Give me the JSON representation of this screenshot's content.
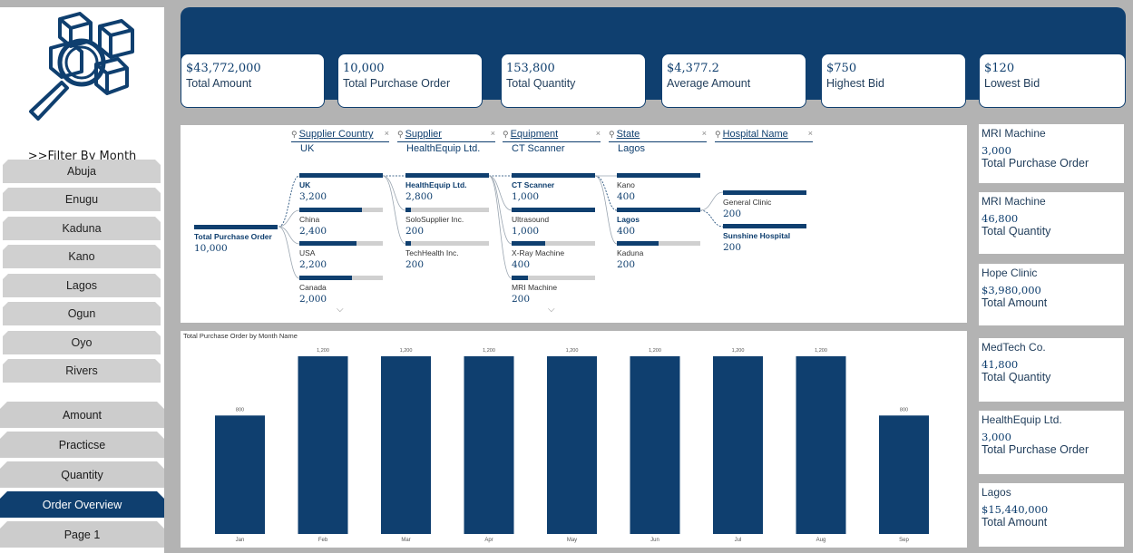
{
  "sidebar": {
    "filter_title": ">>Filter By Month",
    "cities": [
      "Abuja",
      "Enugu",
      "Kaduna",
      "Kano",
      "Lagos",
      "Ogun",
      "Oyo",
      "Rivers"
    ],
    "pages": [
      {
        "label": "Amount",
        "active": false
      },
      {
        "label": "Practicse",
        "active": false
      },
      {
        "label": "Quantity",
        "active": false
      },
      {
        "label": "Order Overview",
        "active": true
      },
      {
        "label": "Page 1",
        "active": false
      }
    ]
  },
  "kpis": [
    {
      "value": "$43,772,000",
      "label": "Total Amount"
    },
    {
      "value": "10,000",
      "label": "Total Purchase Order"
    },
    {
      "value": "153,800",
      "label": "Total Quantity"
    },
    {
      "value": "$4,377.2",
      "label": "Average Amount"
    },
    {
      "value": "$750",
      "label": "Highest Bid"
    },
    {
      "value": "$120",
      "label": "Lowest Bid"
    }
  ],
  "tree": {
    "root": {
      "label": "Total Purchase Order",
      "value": "10,000"
    },
    "levels": [
      {
        "header": "Supplier Country",
        "selected": "UK",
        "nodes": [
          {
            "label": "UK",
            "value": "3,200",
            "fraction": 1.0,
            "sel": true
          },
          {
            "label": "China",
            "value": "2,400",
            "fraction": 0.75
          },
          {
            "label": "USA",
            "value": "2,200",
            "fraction": 0.69
          },
          {
            "label": "Canada",
            "value": "2,000",
            "fraction": 0.63
          }
        ]
      },
      {
        "header": "Supplier",
        "selected": "HealthEquip Ltd.",
        "nodes": [
          {
            "label": "HealthEquip Ltd.",
            "value": "2,800",
            "fraction": 1.0,
            "sel": true
          },
          {
            "label": "SoloSupplier Inc.",
            "value": "200",
            "fraction": 0.07
          },
          {
            "label": "TechHealth Inc.",
            "value": "200",
            "fraction": 0.07
          }
        ]
      },
      {
        "header": "Equipment",
        "selected": "CT Scanner",
        "nodes": [
          {
            "label": "CT Scanner",
            "value": "1,000",
            "fraction": 1.0,
            "sel": true
          },
          {
            "label": "Ultrasound",
            "value": "1,000",
            "fraction": 1.0
          },
          {
            "label": "X-Ray Machine",
            "value": "400",
            "fraction": 0.4
          },
          {
            "label": "MRI Machine",
            "value": "200",
            "fraction": 0.2
          }
        ]
      },
      {
        "header": "State",
        "selected": "Lagos",
        "nodes": [
          {
            "label": "Kano",
            "value": "400",
            "fraction": 1.0
          },
          {
            "label": "Lagos",
            "value": "400",
            "fraction": 1.0,
            "sel": true
          },
          {
            "label": "Kaduna",
            "value": "200",
            "fraction": 0.5
          }
        ]
      },
      {
        "header": "Hospital Name",
        "selected": "",
        "nodes": [
          {
            "label": "General Clinic",
            "value": "200",
            "fraction": 1.0
          },
          {
            "label": "Sunshine Hospital",
            "value": "200",
            "fraction": 1.0,
            "sel": true
          }
        ]
      }
    ]
  },
  "chart_data": {
    "type": "bar",
    "title": "Total Purchase Order by Month Name",
    "categories": [
      "Jan",
      "Feb",
      "Mar",
      "Apr",
      "May",
      "Jun",
      "Jul",
      "Aug",
      "Sep"
    ],
    "values": [
      800,
      1200,
      1200,
      1200,
      1200,
      1200,
      1200,
      1200,
      800
    ],
    "data_labels": [
      "800",
      "1,200",
      "1,200",
      "1,200",
      "1,200",
      "1,200",
      "1,200",
      "1,200",
      "800"
    ],
    "ylim": [
      0,
      1200
    ],
    "color": "#0f3f6f"
  },
  "right_cards": [
    {
      "title": "MRI Machine",
      "value": "3,000",
      "label": "Total Purchase Order"
    },
    {
      "title": "MRI Machine",
      "value": "46,800",
      "label": "Total Quantity"
    },
    {
      "title": "Hope Clinic",
      "value": "$3,980,000",
      "label": "Total Amount"
    },
    {
      "title": "MedTech Co.",
      "value": "41,800",
      "label": "Total Quantity"
    },
    {
      "title": "HealthEquip Ltd.",
      "value": "3,000",
      "label": "Total Purchase Order"
    },
    {
      "title": "Lagos",
      "value": "$15,440,000",
      "label": "Total Amount"
    }
  ],
  "colors": {
    "brand": "#0f3f6f",
    "panel": "#ffffff",
    "background": "#b3b3b3",
    "button": "#d0d0d0"
  }
}
